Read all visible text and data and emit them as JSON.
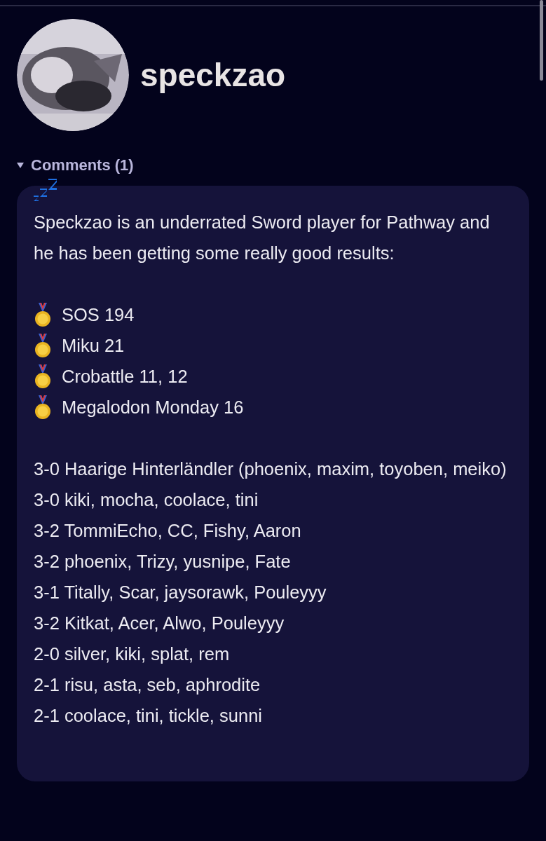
{
  "profile": {
    "name": "speckzao"
  },
  "comments": {
    "label": "Comments (1)",
    "expanded": true,
    "items": [
      {
        "intro": "Speckzao is an underrated Sword player for Pathway and he has been getting some really good results:",
        "medals": [
          "SOS 194",
          "Miku 21",
          "Crobattle 11, 12",
          "Megalodon Monday 16"
        ],
        "results": [
          "3-0 Haarige Hinterländler (phoenix, maxim, toyoben, meiko)",
          "3-0 kiki, mocha, coolace, tini",
          "3-2 TommiEcho, CC, Fishy, Aaron",
          "3-2 phoenix, Trizy, yusnipe, Fate",
          "3-1 Titally, Scar, jaysorawk, Pouleyyy",
          "3-2 Kitkat, Acer, Alwo, Pouleyyy",
          "2-0 silver, kiki, splat, rem",
          "2-1 risu, asta, seb, aphrodite",
          "2-1 coolace, tini, tickle, sunni"
        ]
      }
    ]
  }
}
